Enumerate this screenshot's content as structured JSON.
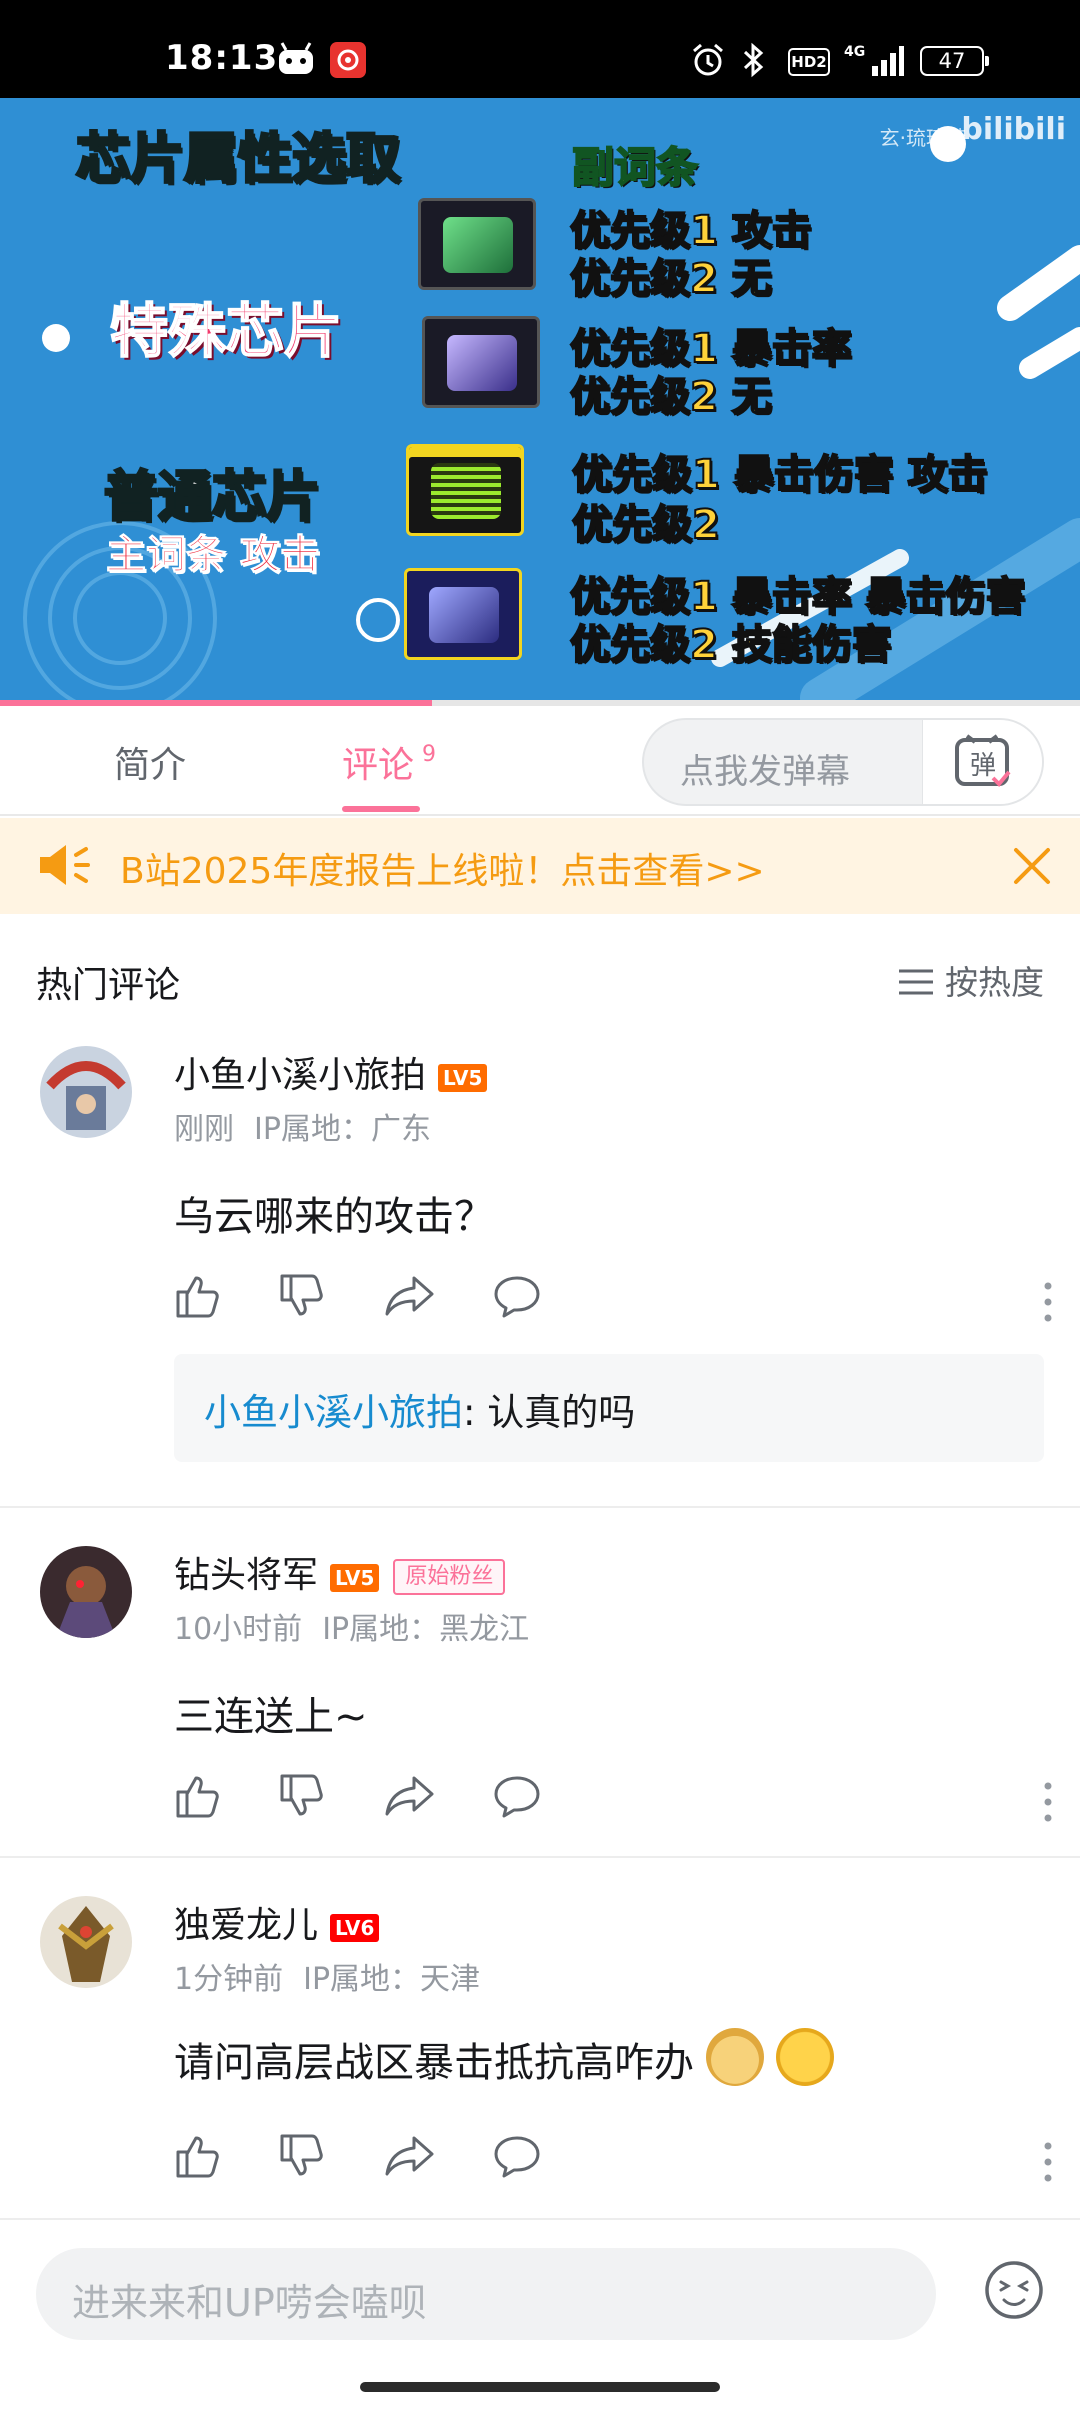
{
  "status_bar": {
    "time": "18:13",
    "hd_label": "HD2",
    "network": "4G",
    "battery": "47"
  },
  "video": {
    "title": "芯片属性选取",
    "special_chip": "特殊芯片",
    "normal_chip": "普通芯片",
    "main_stat": "主词条 攻击",
    "sub_header": "副词条",
    "lines": [
      "优先级1 攻击",
      "优先级2 无",
      "优先级1 暴击率",
      "优先级2 无",
      "优先级1 暴击伤害 攻击",
      "优先级2",
      "优先级1 暴击率 暴击伤害",
      "优先级2 技能伤害"
    ],
    "watermark_small": "玄·琉璃梦",
    "watermark_logo": "bilibili",
    "progress_fraction": 0.4
  },
  "tabs": {
    "intro": "简介",
    "comments": "评论",
    "comments_count": "9",
    "danmaku_placeholder": "点我发弹幕",
    "danmaku_button": "弹"
  },
  "notice": {
    "text": "B站2025年度报告上线啦！点击查看>>"
  },
  "comments_header": {
    "title": "热门评论",
    "sort": "按热度"
  },
  "comments": [
    {
      "user": "小鱼小溪小旅拍",
      "level": "LV5",
      "time": "刚刚",
      "ip": "IP属地：广东",
      "text": "乌云哪来的攻击？",
      "reply_user": "小鱼小溪小旅拍",
      "reply_text": ": 认真的吗"
    },
    {
      "user": "钻头将军",
      "level": "LV5",
      "badge": "原始粉丝",
      "time": "10小时前",
      "ip": "IP属地：黑龙江",
      "text": "三连送上~"
    },
    {
      "user": "独爱龙儿",
      "level": "LV6",
      "time": "1分钟前",
      "ip": "IP属地：天津",
      "text": "请问高层战区暴击抵抗高咋办"
    }
  ],
  "bottom": {
    "input_placeholder": "进来来和UP唠会嗑呗"
  },
  "colors": {
    "accent": "#fb7299",
    "notice_text": "#f59b12",
    "notice_bg": "#fff4e2",
    "reply_user": "#178bcf",
    "video_bg": "#2f8fd4"
  }
}
